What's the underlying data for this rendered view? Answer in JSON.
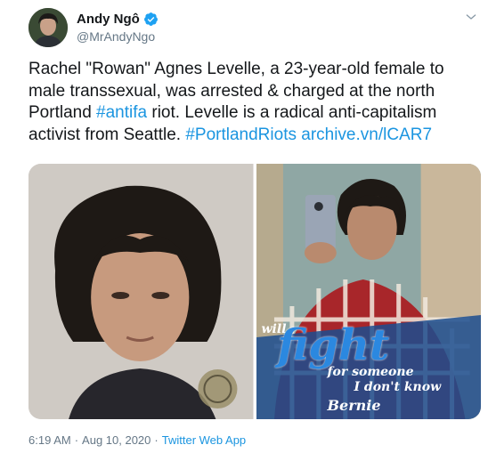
{
  "author": {
    "display_name": "Andy Ngô",
    "handle": "@MrAndyNgo",
    "verified": true
  },
  "tweet": {
    "text_parts": [
      "Rachel \"Rowan\" Agnes Levelle, a 23-year-old female to male transsexual, was arrested & charged at the north Portland ",
      "#antifa",
      " riot. Levelle is a radical anti-capitalism activist from Seattle. ",
      "#PortlandRiots",
      " ",
      "archive.vn/lCAR7"
    ],
    "photo_2_overlay": {
      "line1": "will",
      "line2": "fight",
      "line3": "for someone",
      "line4": "I don't know",
      "line5": "Bernie"
    }
  },
  "meta": {
    "time": "6:19 AM",
    "separator": "·",
    "date": "Aug 10, 2020",
    "app": "Twitter Web App"
  },
  "icons": {
    "verified": "verified-badge-icon",
    "more": "chevron-down-icon"
  },
  "colors": {
    "link": "#1b95e0",
    "verified": "#1da1f2",
    "muted": "#657786",
    "text": "#14171a"
  }
}
